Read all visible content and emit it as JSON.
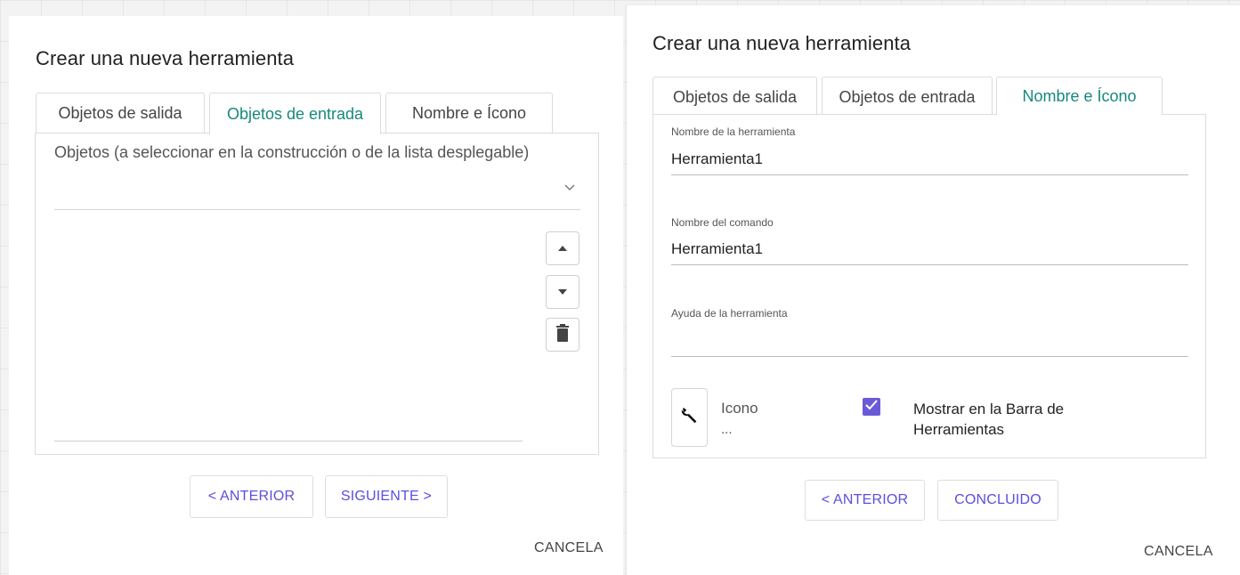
{
  "left_dialog": {
    "title": "Crear una nueva herramienta",
    "tabs": [
      {
        "label": "Objetos de salida",
        "active": false
      },
      {
        "label": "Objetos de entrada",
        "active": true
      },
      {
        "label": "Nombre e Ícono",
        "active": false
      }
    ],
    "objects_label": "Objetos (a seleccionar en la construcción o de la lista desplegable)",
    "objects_select_icon": "chevron-down-icon",
    "side_buttons": [
      "move-up-icon",
      "move-down-icon",
      "trash-icon"
    ],
    "prev_label": "< ANTERIOR",
    "next_label": "SIGUIENTE >",
    "cancel_label": "CANCELA"
  },
  "right_dialog": {
    "title": "Crear una nueva herramienta",
    "tabs": [
      {
        "label": "Objetos de salida",
        "active": false
      },
      {
        "label": "Objetos de entrada",
        "active": false
      },
      {
        "label": "Nombre e Ícono",
        "active": true
      }
    ],
    "tool_name_label": "Nombre de la herramienta",
    "tool_name_value": "Herramienta1",
    "command_name_label": "Nombre del comando",
    "command_name_value": "Herramienta1",
    "help_label": "Ayuda de la herramienta",
    "help_value": "",
    "icon_label": "Icono",
    "icon_sub": "...",
    "icon_glyph": "wrench-icon",
    "show_in_toolbar_label": "Mostrar en la Barra de Herramientas",
    "show_in_toolbar_checked": true,
    "prev_label": "< ANTERIOR",
    "done_label": "CONCLUIDO",
    "cancel_label": "CANCELA"
  },
  "colors": {
    "accent_tab": "#16897b",
    "button_text": "#5c4ee0",
    "checkbox": "#6a5ad8"
  }
}
